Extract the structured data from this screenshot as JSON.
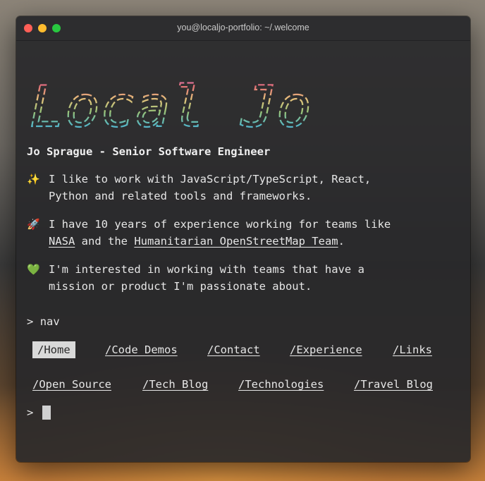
{
  "window": {
    "title": "you@localjo-portfolio: ~/.welcome"
  },
  "logo": {
    "text": "Local Jo",
    "colors": [
      "#c678dd",
      "#e06c75",
      "#e5c07b",
      "#98c379",
      "#56b6c2",
      "#61afef"
    ]
  },
  "heading": "Jo Sprague - Senior Software Engineer",
  "bullets": [
    {
      "icon": "sparkles-icon",
      "emoji": "✨",
      "line1": "I like to work with JavaScript/TypeScript, React,",
      "line2": "Python and related tools and frameworks."
    },
    {
      "icon": "rocket-icon",
      "emoji": "🚀",
      "line1": "I have 10 years of experience working for teams like",
      "link1": "NASA",
      "mid": " and the ",
      "link2": "Humanitarian OpenStreetMap Team",
      "end": "."
    },
    {
      "icon": "green-heart-icon",
      "emoji": "💚",
      "line1": "I'm interested in working with teams that have a",
      "line2": "mission or product I'm passionate about."
    }
  ],
  "prompt": {
    "symbol": ">",
    "command": "nav"
  },
  "nav": {
    "selected": "/Home",
    "row1": [
      "/Home",
      "/Code Demos",
      "/Contact",
      "/Experience",
      "/Links"
    ],
    "row2": [
      "/Open Source",
      "/Tech Blog",
      "/Technologies",
      "/Travel Blog"
    ]
  },
  "prompt2": {
    "symbol": ">"
  }
}
